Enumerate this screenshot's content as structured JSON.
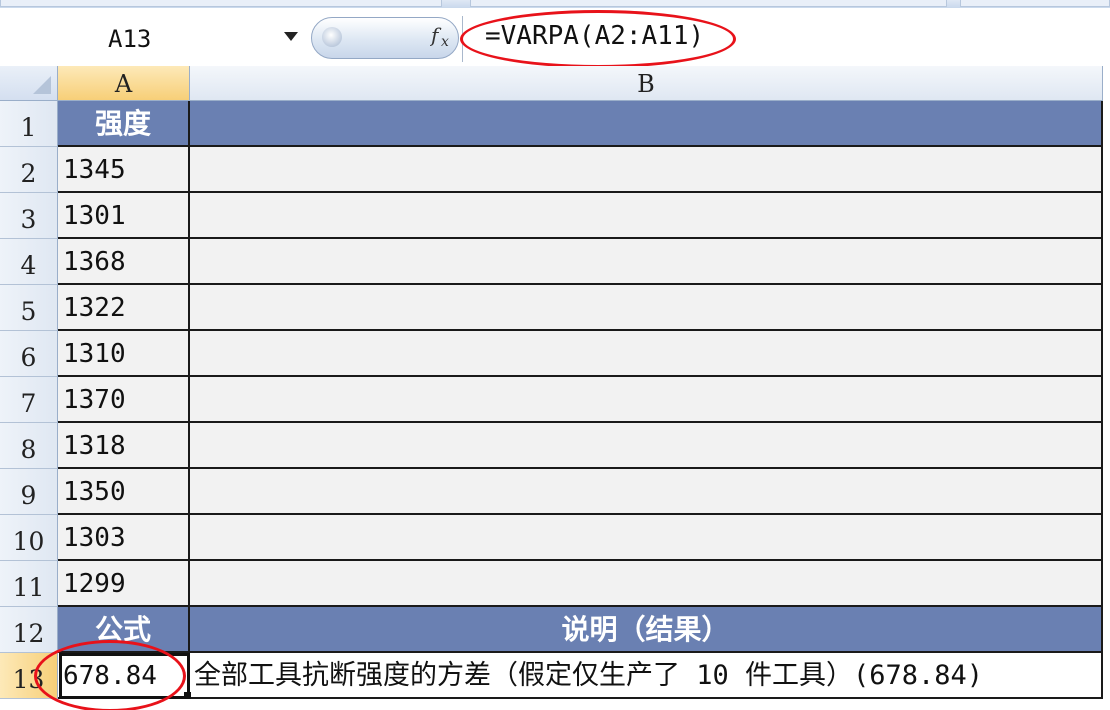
{
  "formula_bar": {
    "name_box": "A13",
    "fx_icon": "fx",
    "formula": "=VARPA(A2:A11)"
  },
  "columns": [
    "A",
    "B"
  ],
  "rows": [
    {
      "num": "1",
      "a": "强度",
      "b": "",
      "style": "header"
    },
    {
      "num": "2",
      "a": "1345",
      "b": "",
      "style": "data"
    },
    {
      "num": "3",
      "a": "1301",
      "b": "",
      "style": "data"
    },
    {
      "num": "4",
      "a": "1368",
      "b": "",
      "style": "data"
    },
    {
      "num": "5",
      "a": "1322",
      "b": "",
      "style": "data"
    },
    {
      "num": "6",
      "a": "1310",
      "b": "",
      "style": "data"
    },
    {
      "num": "7",
      "a": "1370",
      "b": "",
      "style": "data"
    },
    {
      "num": "8",
      "a": "1318",
      "b": "",
      "style": "data"
    },
    {
      "num": "9",
      "a": "1350",
      "b": "",
      "style": "data"
    },
    {
      "num": "10",
      "a": "1303",
      "b": "",
      "style": "data"
    },
    {
      "num": "11",
      "a": "1299",
      "b": "",
      "style": "data"
    },
    {
      "num": "12",
      "a": "公式",
      "b": "说明（结果）",
      "style": "header"
    },
    {
      "num": "13",
      "a": "678.84",
      "b": "全部工具抗断强度的方差（假定仅生产了 10 件工具）(678.84)",
      "style": "result"
    }
  ],
  "selected_cell": "A13",
  "colors": {
    "header_fill": "#6a80b2",
    "highlight": "#e8121a",
    "active_header": "#f7cf78"
  }
}
